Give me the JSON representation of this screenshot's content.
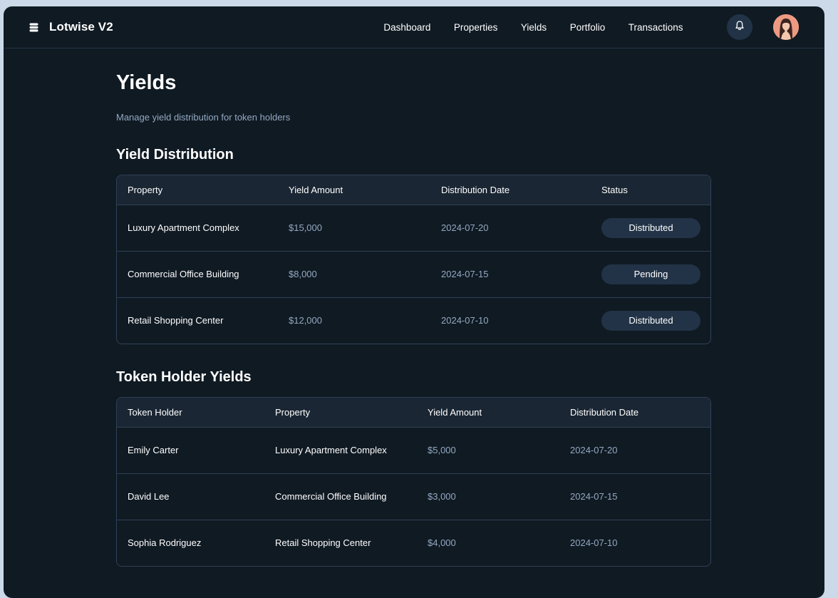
{
  "app": {
    "name": "Lotwise V2"
  },
  "nav": {
    "items": [
      "Dashboard",
      "Properties",
      "Yields",
      "Portfolio",
      "Transactions"
    ]
  },
  "icons": {
    "brand": "stack-icon",
    "notifications": "bell-icon",
    "avatar": "user-avatar"
  },
  "colors": {
    "background": "#101a23",
    "accent": "#223347",
    "muted_text": "#93a9c1",
    "border": "#2e4156"
  },
  "page": {
    "title": "Yields",
    "subtitle": "Manage yield distribution for token holders"
  },
  "yield_distribution": {
    "title": "Yield Distribution",
    "columns": [
      "Property",
      "Yield Amount",
      "Distribution Date",
      "Status"
    ],
    "rows": [
      {
        "property": "Luxury Apartment Complex",
        "amount": "$15,000",
        "date": "2024-07-20",
        "status": "Distributed"
      },
      {
        "property": "Commercial Office Building",
        "amount": "$8,000",
        "date": "2024-07-15",
        "status": "Pending"
      },
      {
        "property": "Retail Shopping Center",
        "amount": "$12,000",
        "date": "2024-07-10",
        "status": "Distributed"
      }
    ]
  },
  "token_holder_yields": {
    "title": "Token Holder Yields",
    "columns": [
      "Token Holder",
      "Property",
      "Yield Amount",
      "Distribution Date"
    ],
    "rows": [
      {
        "holder": "Emily Carter",
        "property": "Luxury Apartment Complex",
        "amount": "$5,000",
        "date": "2024-07-20"
      },
      {
        "holder": "David Lee",
        "property": "Commercial Office Building",
        "amount": "$3,000",
        "date": "2024-07-15"
      },
      {
        "holder": "Sophia Rodriguez",
        "property": "Retail Shopping Center",
        "amount": "$4,000",
        "date": "2024-07-10"
      }
    ]
  }
}
